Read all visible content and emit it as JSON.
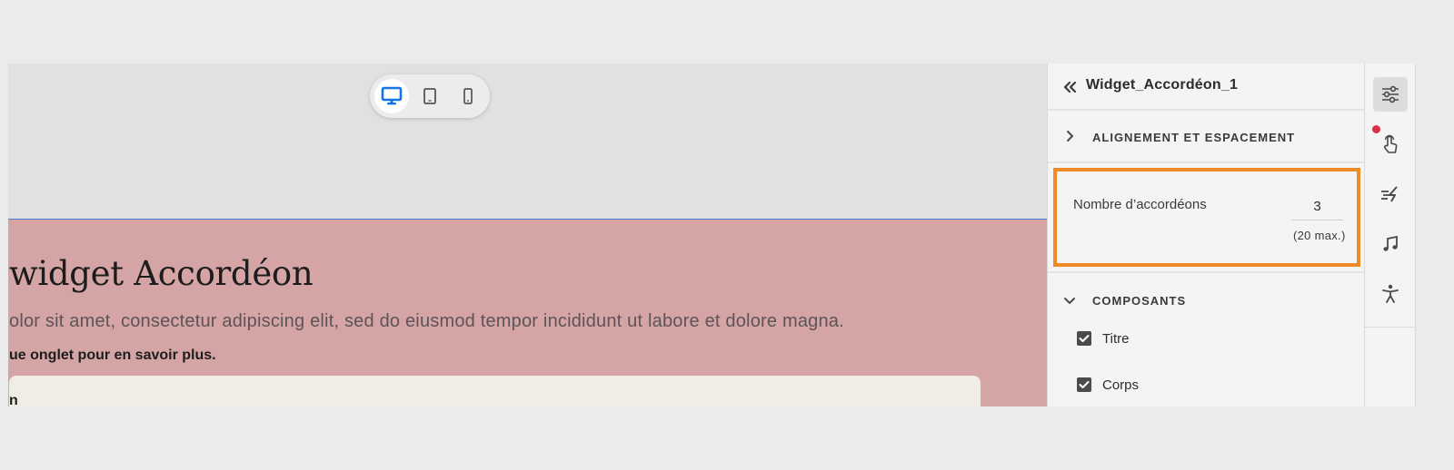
{
  "stage": {
    "device_modes": [
      "desktop",
      "tablet",
      "mobile"
    ],
    "active_device": "desktop"
  },
  "widget": {
    "title": "widget Accordéon",
    "description": "olor sit amet, consectetur adipiscing elit, sed do eiusmod tempor incididunt ut labore et dolore magna.",
    "hint": "ue onglet pour en savoir plus.",
    "first_item_label": "n"
  },
  "panel": {
    "title": "Widget_Accordéon_1",
    "sections": {
      "alignment": {
        "label": "ALIGNEMENT ET ESPACEMENT",
        "expanded": false
      },
      "components": {
        "label": "COMPOSANTS",
        "expanded": true
      }
    },
    "accordion_count": {
      "label": "Nombre d’accordéons",
      "value": "3",
      "max_note": "(20 max.)"
    },
    "components": [
      {
        "label": "Titre",
        "checked": true
      },
      {
        "label": "Corps",
        "checked": true
      }
    ]
  },
  "rail": {
    "icons": [
      "properties-icon",
      "interaction-icon",
      "animation-icon",
      "audio-icon",
      "accessibility-icon"
    ],
    "active": "properties-icon"
  },
  "colors": {
    "highlight_box": "#f08a24",
    "device_active": "#1473e6",
    "widget_background": "#d5a5a6",
    "notification_dot": "#d6314a"
  }
}
